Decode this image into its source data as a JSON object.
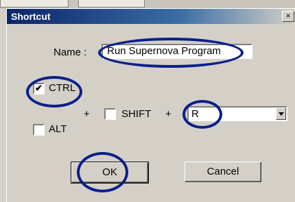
{
  "window": {
    "title": "Shortcut",
    "close_glyph": "×"
  },
  "form": {
    "name_label": "Name :",
    "name_value": "Run Supernova Program",
    "ctrl_label": "CTRL",
    "ctrl_checked": true,
    "alt_label": "ALT",
    "alt_checked": false,
    "plus1": "+",
    "shift_label": "SHIFT",
    "shift_checked": false,
    "plus2": "+",
    "key_value": "R"
  },
  "buttons": {
    "ok_label": "OK",
    "cancel_label": "Cancel"
  },
  "annotation_color": "#0a1f8a",
  "checkmark_glyph": "✔"
}
